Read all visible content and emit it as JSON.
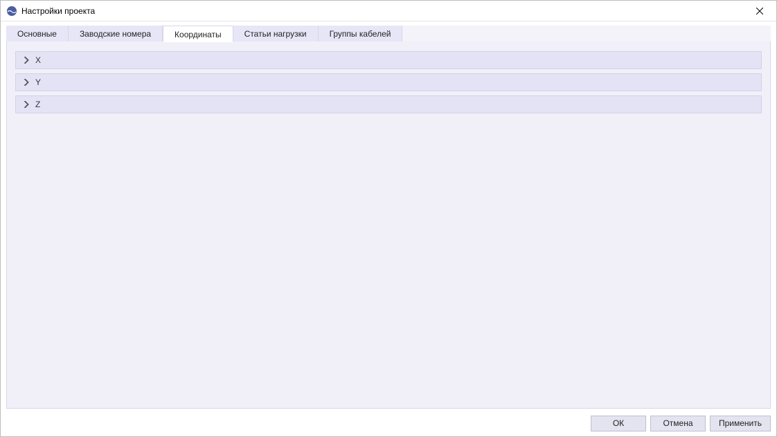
{
  "window": {
    "title": "Настройки проекта"
  },
  "tabs": {
    "t0": {
      "label": "Основные"
    },
    "t1": {
      "label": "Заводские номера"
    },
    "t2": {
      "label": "Координаты"
    },
    "t3": {
      "label": "Статьи нагрузки"
    },
    "t4": {
      "label": "Группы кабелей"
    },
    "active_index": 2
  },
  "accordion": {
    "items": [
      {
        "label": "X"
      },
      {
        "label": "Y"
      },
      {
        "label": "Z"
      }
    ]
  },
  "buttons": {
    "ok": "ОК",
    "cancel": "Отмена",
    "apply": "Применить"
  }
}
